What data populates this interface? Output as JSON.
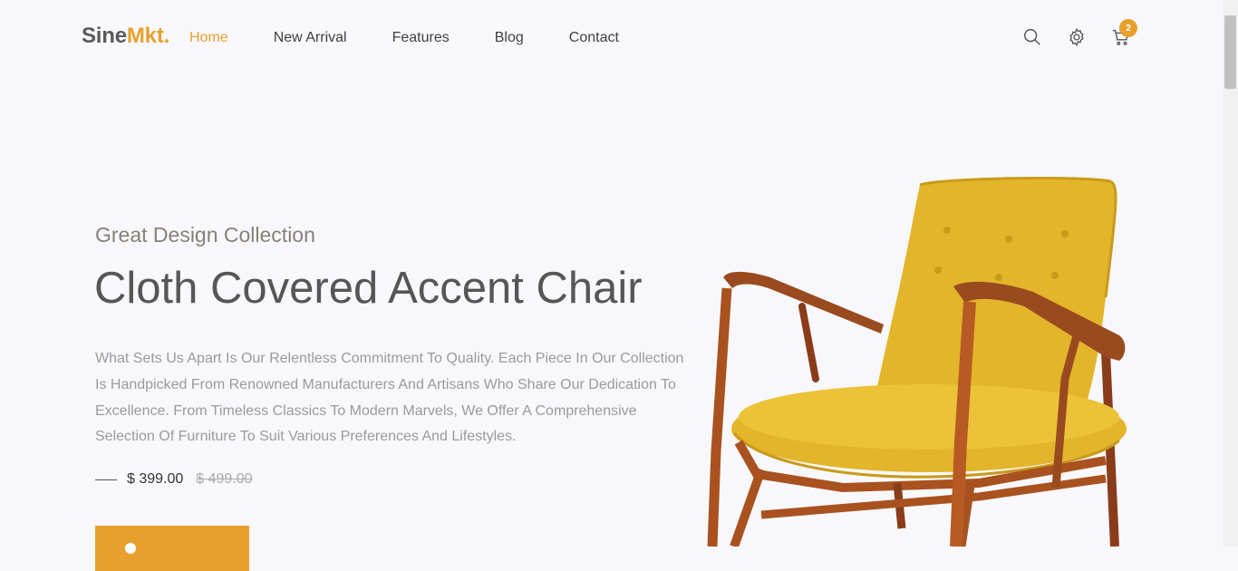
{
  "brand": {
    "name": "Sine",
    "accent": "Mkt."
  },
  "nav": [
    {
      "label": "Home",
      "active": true
    },
    {
      "label": "New Arrival",
      "active": false
    },
    {
      "label": "Features",
      "active": false
    },
    {
      "label": "Blog",
      "active": false
    },
    {
      "label": "Contact",
      "active": false
    }
  ],
  "header_icons": {
    "search": "search-icon",
    "settings": "gear-icon",
    "cart": "cart-icon",
    "cart_count": "2"
  },
  "hero": {
    "eyebrow": "Great Design Collection",
    "title": "Cloth Covered Accent Chair",
    "description": "What Sets Us Apart Is Our Relentless Commitment To Quality. Each Piece In Our Collection Is Handpicked From Renowned Manufacturers And Artisans Who Share Our Dedication To Excellence. From Timeless Classics To Modern Marvels, We Offer A Comprehensive Selection Of Furniture To Suit Various Preferences And Lifestyles.",
    "price_current": "$ 399.00",
    "price_old": "$ 499.00"
  },
  "colors": {
    "accent": "#e8a02d",
    "text": "#565656",
    "muted": "#9a9a9a",
    "background": "#f8f8fc"
  }
}
